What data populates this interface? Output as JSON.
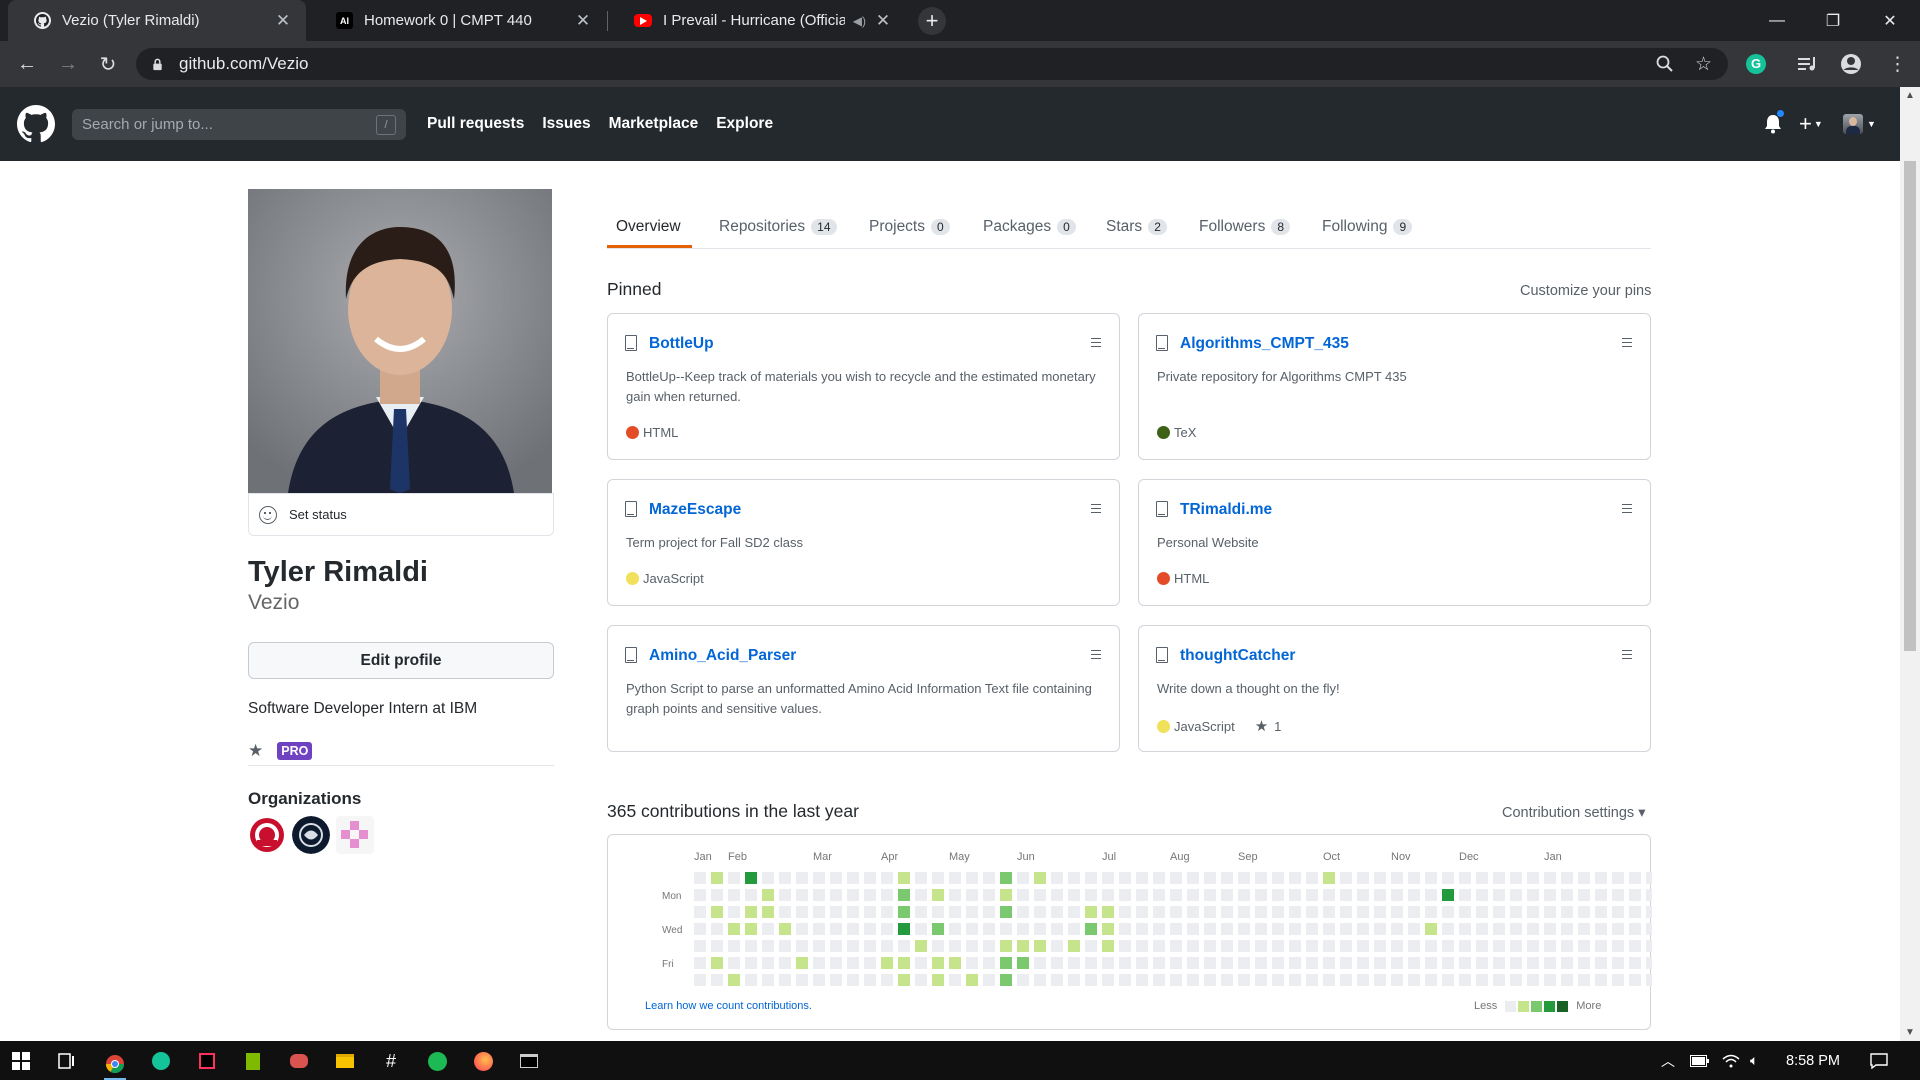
{
  "browser": {
    "tabs": [
      {
        "title": "Vezio (Tyler Rimaldi)",
        "favicon": "github-icon",
        "active": true
      },
      {
        "title": "Homework 0 | CMPT 440",
        "favicon": "ai-icon",
        "active": false
      },
      {
        "title": "I Prevail - Hurricane (Official",
        "favicon": "youtube-icon",
        "active": false
      }
    ],
    "url": "github.com/Vezio"
  },
  "gh_header": {
    "search_placeholder": "Search or jump to...",
    "search_shortcut": "/",
    "nav": [
      "Pull requests",
      "Issues",
      "Marketplace",
      "Explore"
    ],
    "notification_dot_color": "#2188ff"
  },
  "profile": {
    "set_status": "Set status",
    "name": "Tyler Rimaldi",
    "username": "Vezio",
    "edit_profile": "Edit profile",
    "bio": "Software Developer Intern at IBM",
    "badge": "PRO",
    "organizations_title": "Organizations"
  },
  "tabs": [
    {
      "label": "Overview",
      "count": null
    },
    {
      "label": "Repositories",
      "count": "14"
    },
    {
      "label": "Projects",
      "count": "0"
    },
    {
      "label": "Packages",
      "count": "0"
    },
    {
      "label": "Stars",
      "count": "2"
    },
    {
      "label": "Followers",
      "count": "8"
    },
    {
      "label": "Following",
      "count": "9"
    }
  ],
  "pinned": {
    "title": "Pinned",
    "customize": "Customize your pins",
    "cards": [
      {
        "name": "BottleUp",
        "desc": "BottleUp--Keep track of materials you wish to recycle and the estimated monetary gain when returned.",
        "lang": "HTML",
        "lang_color": "#e34c26",
        "stars": null
      },
      {
        "name": "Algorithms_CMPT_435",
        "desc": "Private repository for Algorithms CMPT 435",
        "lang": "TeX",
        "lang_color": "#3D6117",
        "stars": null
      },
      {
        "name": "MazeEscape",
        "desc": "Term project for Fall SD2 class",
        "lang": "JavaScript",
        "lang_color": "#f1e05a",
        "stars": null
      },
      {
        "name": "TRimaldi.me",
        "desc": "Personal Website",
        "lang": "HTML",
        "lang_color": "#e34c26",
        "stars": null
      },
      {
        "name": "Amino_Acid_Parser",
        "desc": "Python Script to parse an unformatted Amino Acid Information Text file containing graph points and sensitive values.",
        "lang": "",
        "lang_color": "",
        "stars": null
      },
      {
        "name": "thoughtCatcher",
        "desc": "Write down a thought on the fly!",
        "lang": "JavaScript",
        "lang_color": "#f1e05a",
        "stars": "1"
      }
    ]
  },
  "contributions": {
    "title": "365 contributions in the last year",
    "settings": "Contribution settings ▾",
    "months": [
      "Jan",
      "Feb",
      "Mar",
      "Apr",
      "May",
      "Jun",
      "Jul",
      "Aug",
      "Sep",
      "Oct",
      "Nov",
      "Dec",
      "Jan"
    ],
    "days": [
      "Mon",
      "Wed",
      "Fri"
    ],
    "learn": "Learn how we count contributions.",
    "less": "Less",
    "more": "More",
    "colors": [
      "#ebedf0",
      "#c6e48b",
      "#7bc96f",
      "#239a3b",
      "#196127"
    ],
    "weeks": "0000000|1010010|0001001|3011000|0110000|0001000|0000010|0000000|0000000|0000000|0000000|0000010|1223011|0000100|0102011|0000010|0000001|0000000|2120122|0000120|1000100|0000000|0000100|0012000|0011100|0000000|0000000|0000000|0000000|0000000|0000000|0000000|0000000|0000000|0000000|0000000|0000000|1000000|0000000|0000000|0000000|0000000|0000000|0001000|0300000|0000000|0000000|0000000|0000000|0000000|0000000|0000000|0000000|0000000|0000000|0000000|0000000|0000000|0000000"
  },
  "taskbar": {
    "time": "8:58 PM"
  }
}
